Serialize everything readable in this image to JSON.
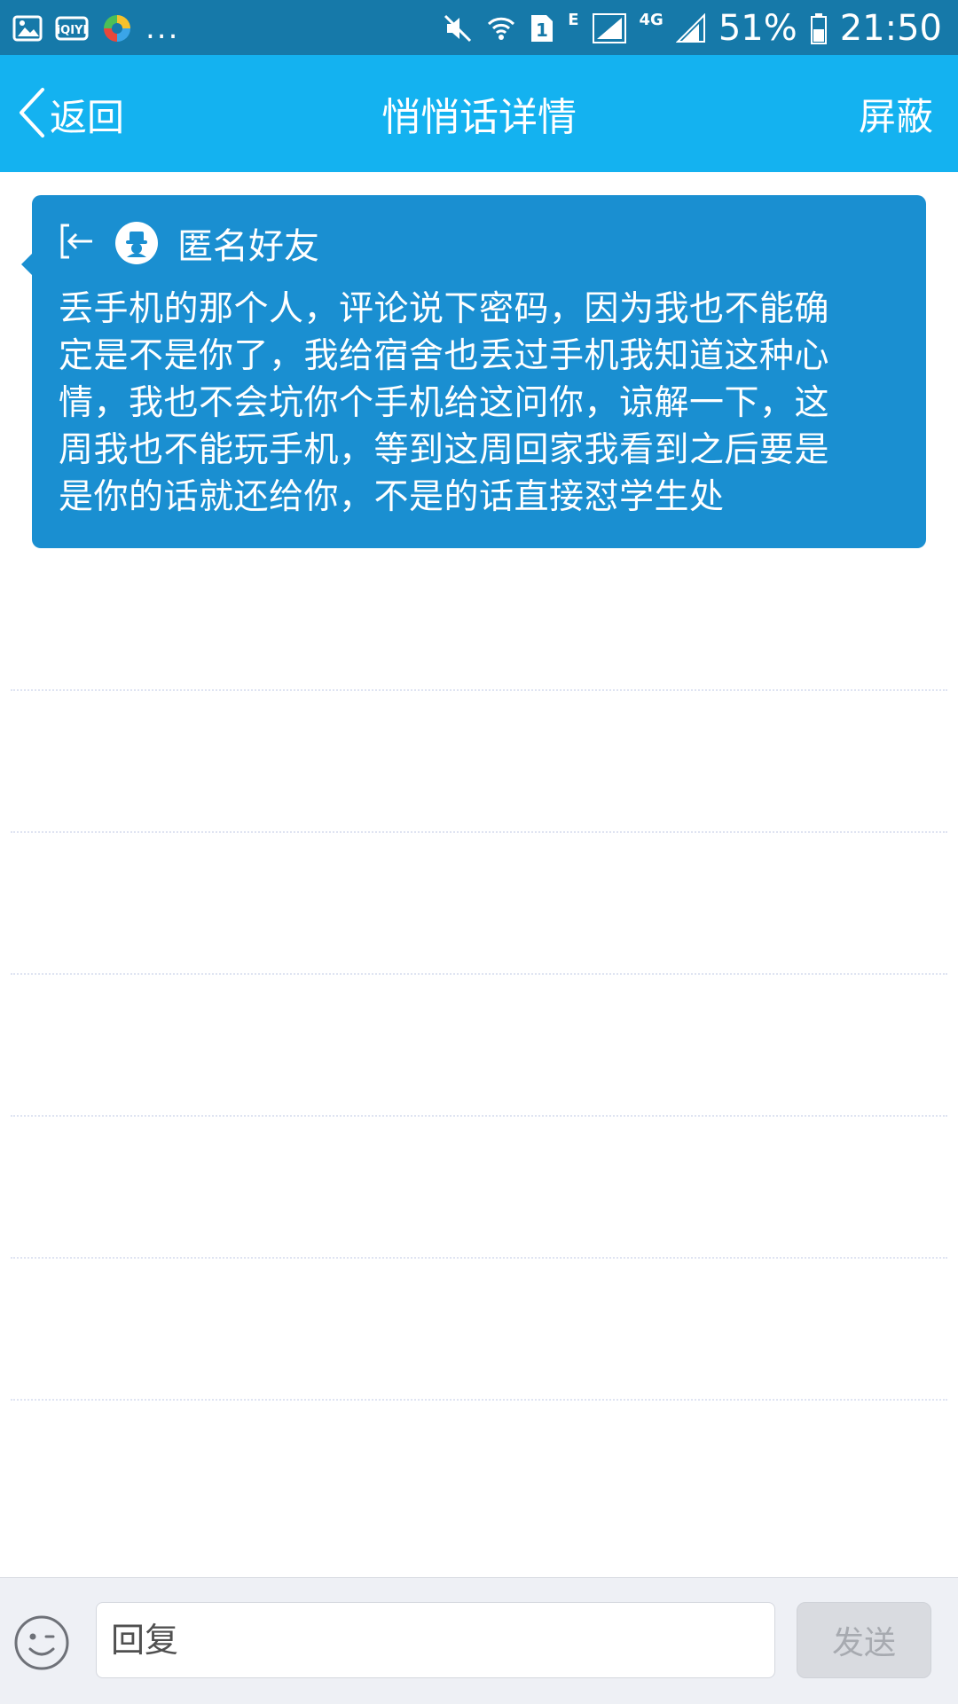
{
  "status_bar": {
    "left_icons": [
      "gallery-icon",
      "iqiyi-icon",
      "app-icon"
    ],
    "overflow": "...",
    "network_e": "E",
    "network_4g": "4G",
    "sim_slot": "1",
    "battery_percent": "51%",
    "time": "21:50"
  },
  "header": {
    "back_label": "返回",
    "title": "悄悄话详情",
    "block_label": "屏蔽"
  },
  "message": {
    "sender": "匿名好友",
    "lines": [
      "丢手机的那个人，评论说下密码，因为我也不能确",
      "定是不是你了，我给宿舍也丢过手机我知道这种心",
      "情，我也不会坑你个手机给这问你，谅解一下，这",
      "周我也不能玩手机，等到这周回家我看到之后要是",
      "是你的话就还给你，不是的话直接怼学生处"
    ]
  },
  "reply": {
    "placeholder": "回复",
    "send_label": "发送"
  },
  "colors": {
    "status_bar": "#1679a9",
    "title_bar": "#14b2f0",
    "card": "#1a8fd1"
  }
}
